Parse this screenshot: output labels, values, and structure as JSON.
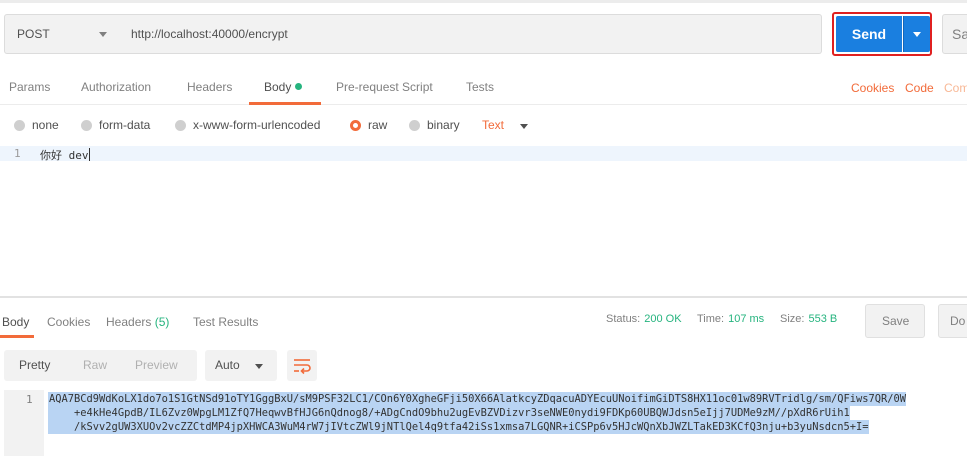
{
  "request": {
    "method": "POST",
    "url": "http://localhost:40000/encrypt",
    "send_label": "Send",
    "save_label": "Sa"
  },
  "request_tabs": {
    "params": "Params",
    "authorization": "Authorization",
    "headers": "Headers",
    "body": "Body",
    "prerequest": "Pre-request Script",
    "tests": "Tests",
    "cookies": "Cookies",
    "code": "Code",
    "comments": "Com"
  },
  "body_types": {
    "none": "none",
    "form_data": "form-data",
    "urlencoded": "x-www-form-urlencoded",
    "raw": "raw",
    "binary": "binary",
    "selected": "raw",
    "text_type": "Text"
  },
  "editor": {
    "line_number": "1",
    "content": "你好 dev"
  },
  "response_tabs": {
    "body": "Body",
    "cookies": "Cookies",
    "headers": "Headers",
    "headers_count": "(5)",
    "test_results": "Test Results"
  },
  "response_meta": {
    "status_label": "Status:",
    "status_value": "200 OK",
    "time_label": "Time:",
    "time_value": "107 ms",
    "size_label": "Size:",
    "size_value": "553 B",
    "save_button": "Save",
    "download_button": "Do"
  },
  "response_view": {
    "pretty": "Pretty",
    "raw": "Raw",
    "preview": "Preview",
    "format": "Auto"
  },
  "response_body": {
    "line_number": "1",
    "lines": [
      "AQA7BCd9WdKoLX1do7o1S1GtNSd91oTY1GggBxU/sM9PSF32LC1/COn6Y0XgheGFji50X66AlatkcyZDqacuADYEcuUNoifimGiDTS8HX11oc01w89RVTridlg/sm/QFiws7QR/0W",
      "    +e4kHe4GpdB/IL6Zvz0WpgLM1ZfQ7HeqwvBfHJG6nQdnog8/+ADgCndO9bhu2ugEvBZVDizvr3seNWE0nydi9FDKp60UBQWJdsn5eIjj7UDMe9zM//pXdR6rUih1",
      "    /kSvv2gUW3XUOv2vcZZCtdMP4jpXHWCA3WuM4rW7jIVtcZWl9jNTlQel4q9tfa42iSs1xmsa7LGQNR+iCSPp6v5HJcWQnXbJWZLTakED3KCfQ3nju+b3yuNsdcn5+I="
    ]
  },
  "colors": {
    "accent": "#f26b3a",
    "send_blue": "#1a7fe0",
    "success_green": "#26b47f",
    "highlight_red": "#e02020",
    "selection": "#b9d4f3"
  }
}
